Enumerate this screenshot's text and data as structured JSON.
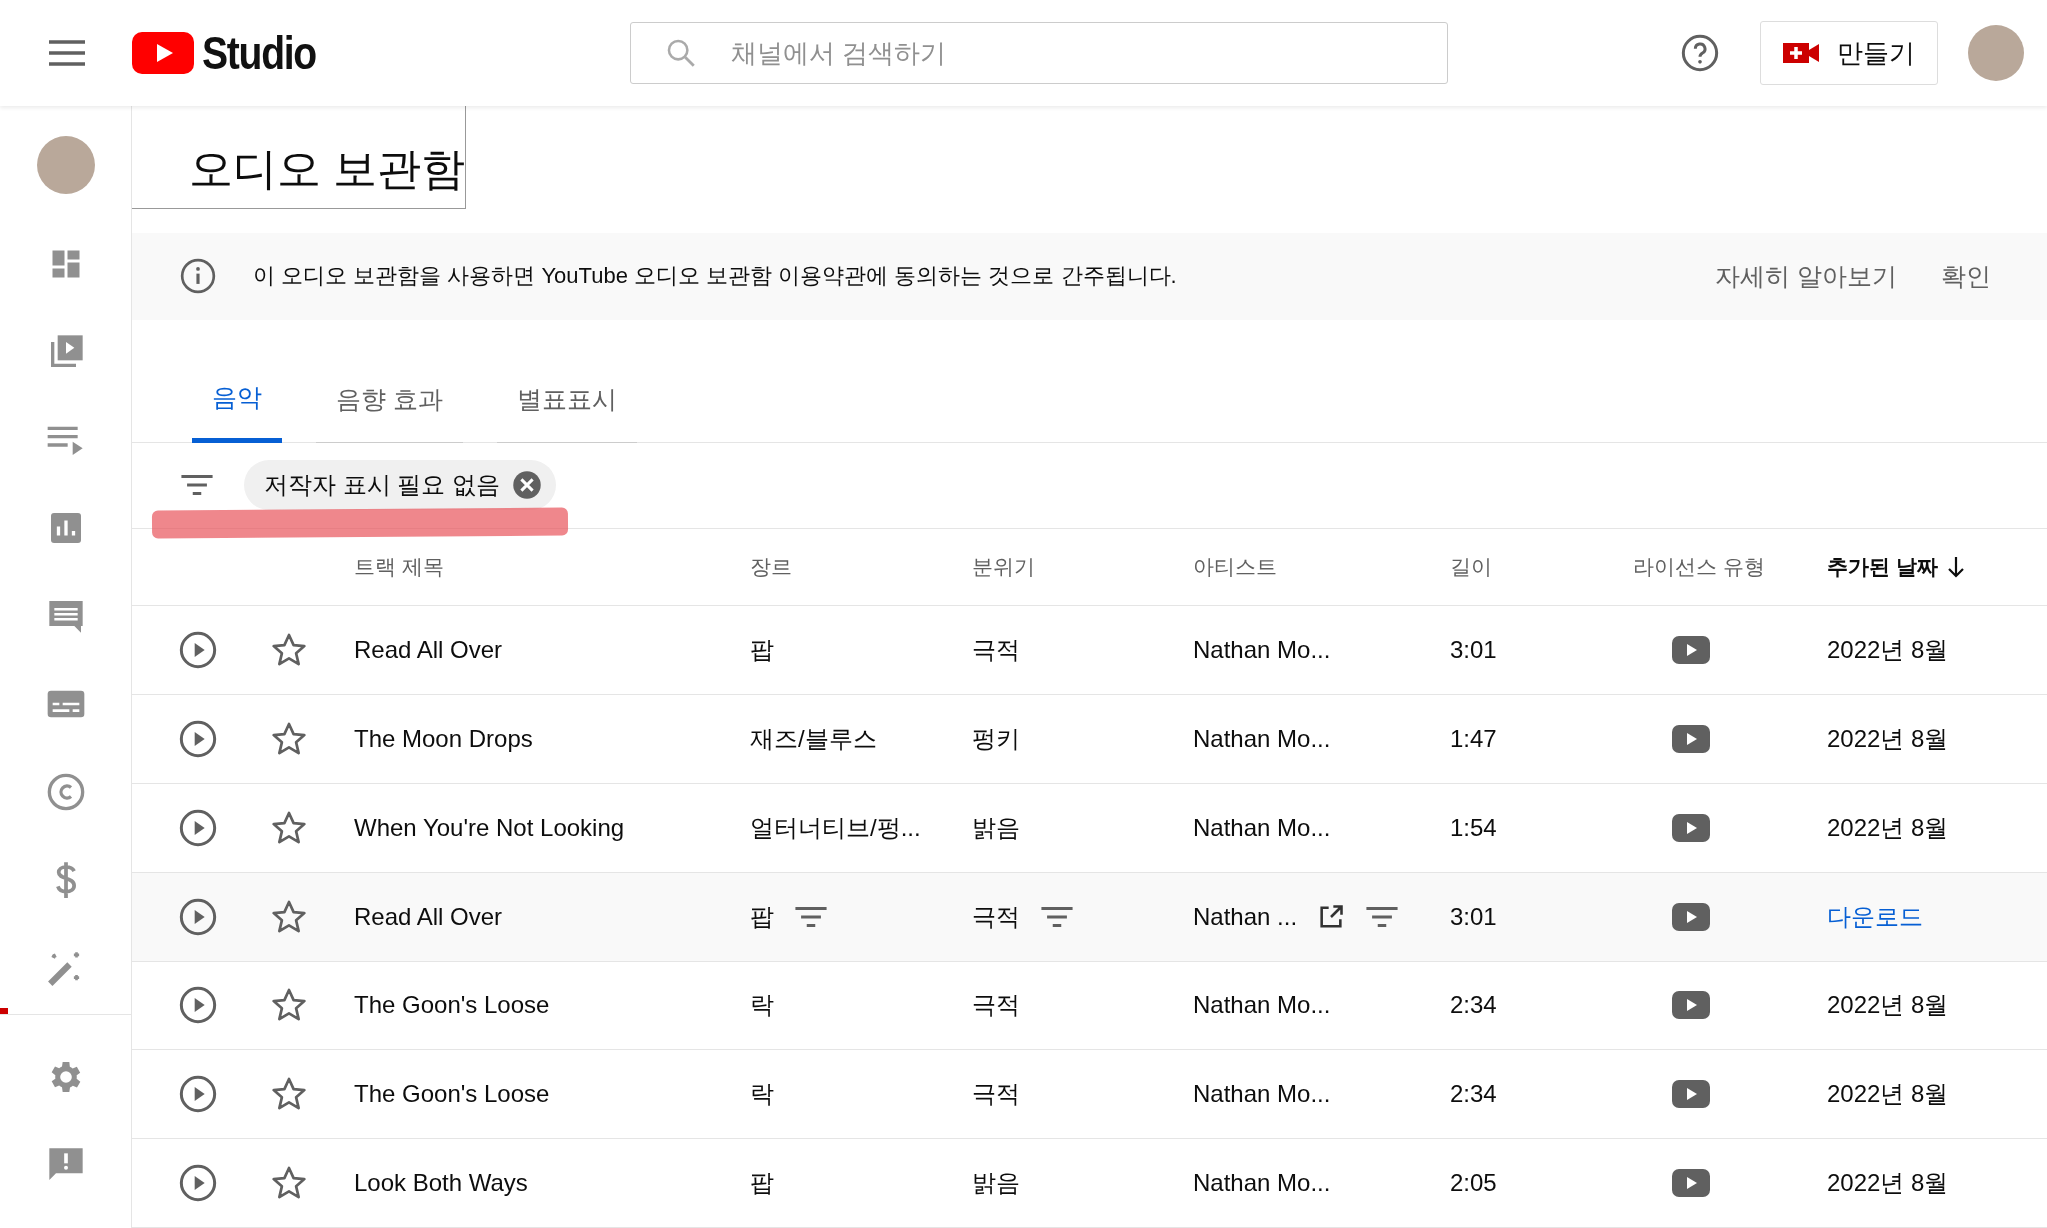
{
  "header": {
    "logo_text": "Studio",
    "search_placeholder": "채널에서 검색하기",
    "create_button": "만들기"
  },
  "page_title": "오디오 보관함",
  "banner": {
    "text": "이 오디오 보관함을 사용하면 YouTube 오디오 보관함 이용약관에 동의하는 것으로 간주됩니다.",
    "learn_more": "자세히 알아보기",
    "confirm": "확인"
  },
  "tabs": [
    {
      "label": "음악",
      "selected": true
    },
    {
      "label": "음향 효과",
      "selected": false
    },
    {
      "label": "별표표시",
      "selected": false
    }
  ],
  "filter_chip": {
    "label": "저작자 표시 필요 없음"
  },
  "table": {
    "columns": [
      {
        "label": "트랙 제목",
        "sorted": false
      },
      {
        "label": "장르",
        "sorted": false
      },
      {
        "label": "분위기",
        "sorted": false
      },
      {
        "label": "아티스트",
        "sorted": false
      },
      {
        "label": "길이",
        "sorted": false
      },
      {
        "label": "라이선스 유형",
        "sorted": false
      },
      {
        "label": "추가된 날짜",
        "sorted": true
      }
    ],
    "rows": [
      {
        "title": "Read All Over",
        "genre": "팝",
        "mood": "극적",
        "artist": "Nathan Mo...",
        "length": "3:01",
        "date": "2022년 8월",
        "hovered": false
      },
      {
        "title": "The Moon Drops",
        "genre": "재즈/블루스",
        "mood": "펑키",
        "artist": "Nathan Mo...",
        "length": "1:47",
        "date": "2022년 8월",
        "hovered": false
      },
      {
        "title": "When You're Not Looking",
        "genre": "얼터너티브/펑...",
        "mood": "밝음",
        "artist": "Nathan Mo...",
        "length": "1:54",
        "date": "2022년 8월",
        "hovered": false
      },
      {
        "title": "Read All Over",
        "genre": "팝",
        "mood": "극적",
        "artist": "Nathan ...",
        "length": "3:01",
        "download": "다운로드",
        "hovered": true
      },
      {
        "title": "The Goon's Loose",
        "genre": "락",
        "mood": "극적",
        "artist": "Nathan Mo...",
        "length": "2:34",
        "date": "2022년 8월",
        "hovered": false
      },
      {
        "title": "The Goon's Loose",
        "genre": "락",
        "mood": "극적",
        "artist": "Nathan Mo...",
        "length": "2:34",
        "date": "2022년 8월",
        "hovered": false
      },
      {
        "title": "Look Both Ways",
        "genre": "팝",
        "mood": "밝음",
        "artist": "Nathan Mo...",
        "length": "2:05",
        "date": "2022년 8월",
        "hovered": false
      }
    ]
  }
}
